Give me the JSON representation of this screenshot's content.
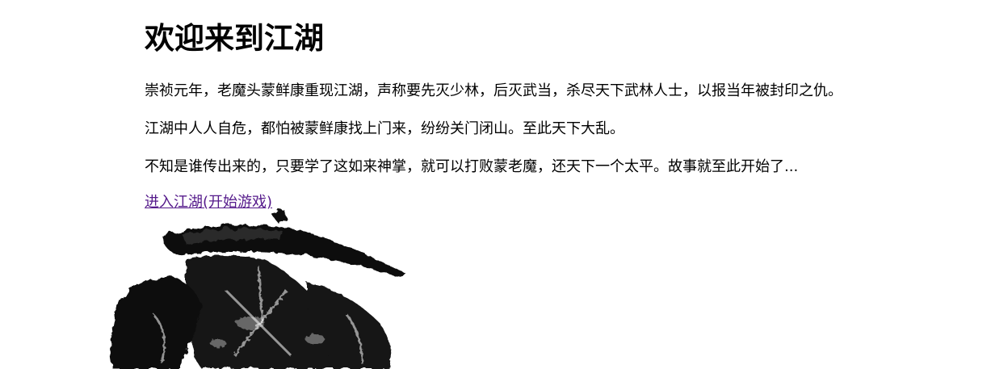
{
  "page": {
    "heading": "欢迎来到江湖",
    "paragraphs": [
      "崇祯元年，老魔头蒙鲜康重现江湖，声称要先灭少林，后灭武当，杀尽天下武林人士，以报当年被封印之仇。",
      "江湖中人人自危，都怕被蒙鲜康找上门来，纷纷关门闭山。至此天下大乱。",
      "不知是谁传出来的，只要学了这如来神掌，就可以打败蒙老魔，还天下一个太平。故事就至此开始了..."
    ],
    "enter_link": "进入江湖(开始游戏)",
    "link_color": "#551a8b"
  }
}
